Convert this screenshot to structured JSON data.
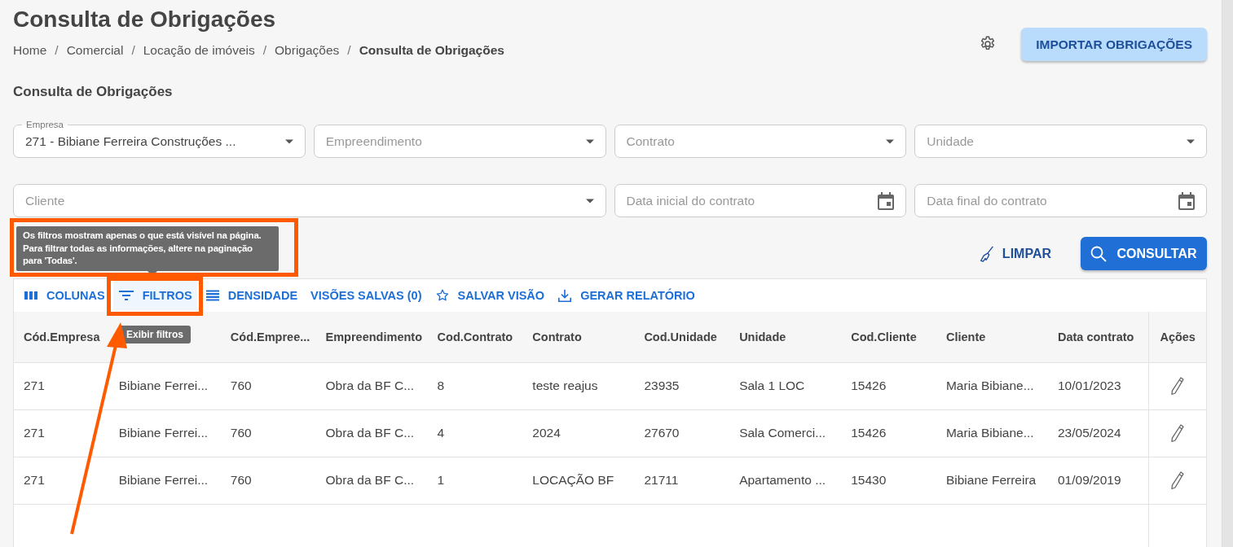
{
  "page_title": "Consulta de Obrigações",
  "breadcrumb": [
    {
      "kind": "link",
      "label": "Home",
      "current": false
    },
    {
      "kind": "separator",
      "label": "/"
    },
    {
      "kind": "link",
      "label": "Comercial",
      "current": false
    },
    {
      "kind": "separator",
      "label": "/"
    },
    {
      "kind": "link",
      "label": "Locação de imóveis",
      "current": false
    },
    {
      "kind": "separator",
      "label": "/"
    },
    {
      "kind": "link",
      "label": "Obrigações",
      "current": false
    },
    {
      "kind": "separator",
      "label": "/"
    },
    {
      "kind": "link",
      "label": "Consulta de Obrigações",
      "current": true
    }
  ],
  "import_button": "IMPORTAR OBRIGAÇÕES",
  "section_title": "Consulta de Obrigações",
  "filters_row_1": [
    {
      "kind": "select",
      "label": "Empresa",
      "value": "271 - Bibiane Ferreira Construções ..."
    },
    {
      "kind": "select",
      "placeholder": "Empreendimento"
    },
    {
      "kind": "select",
      "placeholder": "Contrato"
    },
    {
      "kind": "select",
      "placeholder": "Unidade"
    }
  ],
  "filters_row_2": [
    {
      "kind": "select",
      "placeholder": "Cliente"
    },
    {
      "kind": "date",
      "placeholder": "Data inicial do contrato"
    },
    {
      "kind": "date",
      "placeholder": "Data final do contrato"
    }
  ],
  "info_tooltip": {
    "text": "Os filtros mostram apenas o que está visível na página. Para filtrar todas as informações, altere na paginação para 'Todas'.",
    "highlighted": true
  },
  "clear_button": "LIMPAR",
  "search_button": "CONSULTAR",
  "toolbar": [
    {
      "kind": "columns",
      "label": "COLUNAS",
      "highlighted": false,
      "hovered": false
    },
    {
      "kind": "filters",
      "label": "FILTROS",
      "highlighted": true,
      "hovered": true
    },
    {
      "kind": "density",
      "label": "DENSIDADE",
      "highlighted": false,
      "hovered": false
    },
    {
      "kind": "saved_views",
      "label": "VISÕES SALVAS (0)",
      "highlighted": false,
      "hovered": false
    },
    {
      "kind": "save_view",
      "label": "SALVAR VISÃO",
      "highlighted": false,
      "hovered": false
    },
    {
      "kind": "report",
      "label": "GERAR RELATÓRIO",
      "highlighted": false,
      "hovered": false
    }
  ],
  "button_tooltip": "Exibir filtros",
  "pointer_arrow": true,
  "table": {
    "columns": [
      {
        "label": "Cód.Empresa"
      },
      {},
      {
        "label": "Cód.Empree..."
      },
      {
        "label": "Empreendimento"
      },
      {
        "label": "Cod.Contrato"
      },
      {
        "label": "Contrato"
      },
      {
        "label": "Cod.Unidade"
      },
      {
        "label": "Unidade"
      },
      {
        "label": "Cod.Cliente"
      },
      {
        "label": "Cliente"
      },
      {
        "label": "Data contrato"
      }
    ],
    "actions_header": "Ações",
    "rows": [
      [
        "271",
        "Bibiane Ferrei...",
        "760",
        "Obra da BF C...",
        "8",
        "teste reajus",
        "23935",
        "Sala 1 LOC",
        "15426",
        "Maria Bibiane...",
        "10/01/2023"
      ],
      [
        "271",
        "Bibiane Ferrei...",
        "760",
        "Obra da BF C...",
        "4",
        "2024",
        "27670",
        "Sala Comerci...",
        "15426",
        "Maria Bibiane...",
        "23/05/2024"
      ],
      [
        "271",
        "Bibiane Ferrei...",
        "760",
        "Obra da BF C...",
        "1",
        "LOCAÇÃO BF",
        "21711",
        "Apartamento ...",
        "15430",
        "Bibiane Ferreira",
        "01/09/2019"
      ]
    ]
  }
}
